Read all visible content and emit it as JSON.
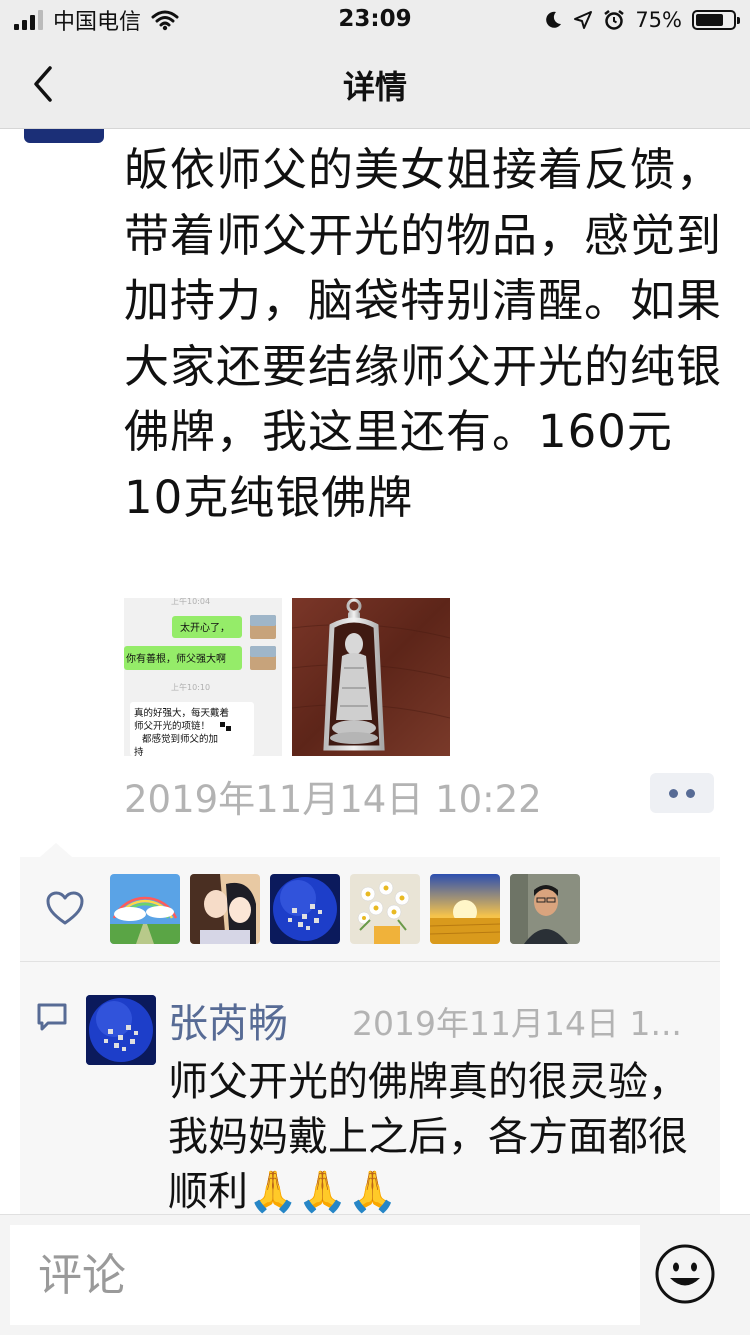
{
  "status_bar": {
    "carrier": "中国电信",
    "time": "23:09",
    "battery_percent": "75%",
    "battery_level": 0.75,
    "icons": [
      "signal-icon",
      "wifi-icon",
      "moon-icon",
      "location-icon",
      "alarm-icon",
      "battery-icon"
    ]
  },
  "nav": {
    "back_icon": "chevron-left-icon",
    "title": "详情"
  },
  "post": {
    "text": "皈依师父的美女姐接着反馈，带着师父开光的物品，感觉到加持力，脑袋特别清醒。如果大家还要结缘师父开光的纯银佛牌，我这里还有。160元10克纯银佛牌",
    "thumbnail_1": {
      "time1": "上午10:04",
      "bubble1": "太开心了，",
      "bubble2": "你有善根，师父强大啊",
      "time2": "上午10:10",
      "bubble3_line1": "真的好强大，每天戴着",
      "bubble3_line2": "师父开光的项链！",
      "bubble3_line3": "都感觉到师父的加",
      "bubble3_line4": "持"
    },
    "thumbnail_2": "silver-buddha-pendant-image",
    "timestamp": "2019年11月14日 10:22",
    "more_icon": "more-dots-icon"
  },
  "likes": {
    "icon": "heart-outline-icon",
    "avatars": [
      "rainbow-sky",
      "anime-couple",
      "blue-sphere",
      "daisy-flowers",
      "sunset-field",
      "man-portrait"
    ]
  },
  "comment": {
    "icon": "comment-bubble-icon",
    "author": "张芮畅",
    "time": "2019年11月14日 1...",
    "text": "师父开光的佛牌真的很灵验，我妈妈戴上之后，各方面都很顺利🙏🙏🙏"
  },
  "bottom_bar": {
    "input_placeholder": "评论",
    "emoji_icon": "smiley-face-icon"
  },
  "colors": {
    "link_blue": "#576b95",
    "time_gray": "#b3b3b3",
    "bar_bg": "#ededed"
  }
}
